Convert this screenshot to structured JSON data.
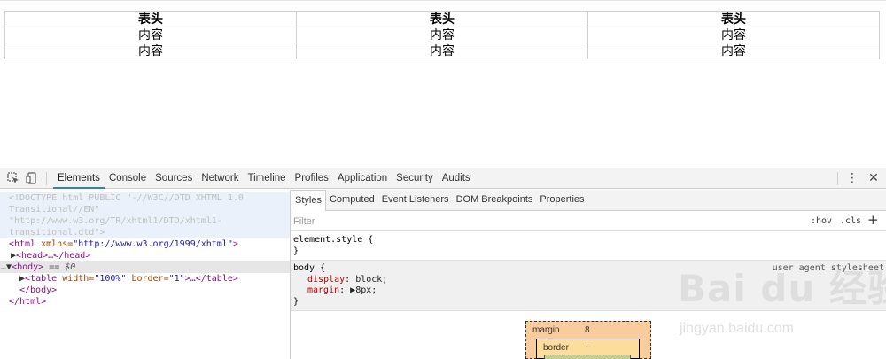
{
  "page": {
    "table": {
      "headers": [
        "表头",
        "表头",
        "表头"
      ],
      "rows": [
        [
          "内容",
          "内容",
          "内容"
        ],
        [
          "内容",
          "内容",
          "内容"
        ]
      ]
    }
  },
  "devtools": {
    "toolbar": {
      "icons": [
        "inspect-element-icon",
        "device-mode-icon"
      ],
      "tabs": [
        "Elements",
        "Console",
        "Sources",
        "Network",
        "Timeline",
        "Profiles",
        "Application",
        "Security",
        "Audits"
      ],
      "active_tab": "Elements",
      "menu_glyph": "⋮",
      "close_glyph": "✕"
    },
    "elements": {
      "doctype_1": "<!DOCTYPE html PUBLIC \"-//W3C//DTD XHTML 1.0",
      "doctype_2": "Transitional//EN\"",
      "doctype_3": "\"http://www.w3.org/TR/xhtml1/DTD/xhtml1-",
      "doctype_4": "transitional.dtd\">",
      "html_open_tag": "<html ",
      "html_attr_name": "xmlns=",
      "html_attr_value": "\"http://www.w3.org/1999/xhtml\"",
      "html_open_end": ">",
      "head_line": "<head>…</head>",
      "body_ellipsis": "…",
      "body_tag": "<body>",
      "body_eq": " == ",
      "body_ref": "$0",
      "table_open": "<table ",
      "table_attr1_name": "width=",
      "table_attr1_value": "\"100%\"",
      "table_attr2_name": " border=",
      "table_attr2_value": "\"1\"",
      "table_close": ">…</table>",
      "body_close": "</body>",
      "html_close": "</html>"
    },
    "styles": {
      "sub_tabs": [
        "Styles",
        "Computed",
        "Event Listeners",
        "DOM Breakpoints",
        "Properties"
      ],
      "active_sub_tab": "Styles",
      "filter_placeholder": "Filter",
      "hov_label": ":hov",
      "cls_label": ".cls",
      "plus_glyph": "+",
      "element_style_selector": "element.style {",
      "close_brace": "}",
      "body_selector": "body {",
      "ua_source": "user agent stylesheet",
      "props": [
        {
          "name": "display",
          "value": "block;"
        },
        {
          "name": "margin",
          "value": "▶8px;"
        }
      ]
    },
    "box_model": {
      "margin_label": "margin",
      "margin_value": "8",
      "border_label": "border",
      "border_value": "–"
    }
  },
  "watermark": {
    "main": "Bai du 经验",
    "sub": "jingyan.baidu.com"
  }
}
